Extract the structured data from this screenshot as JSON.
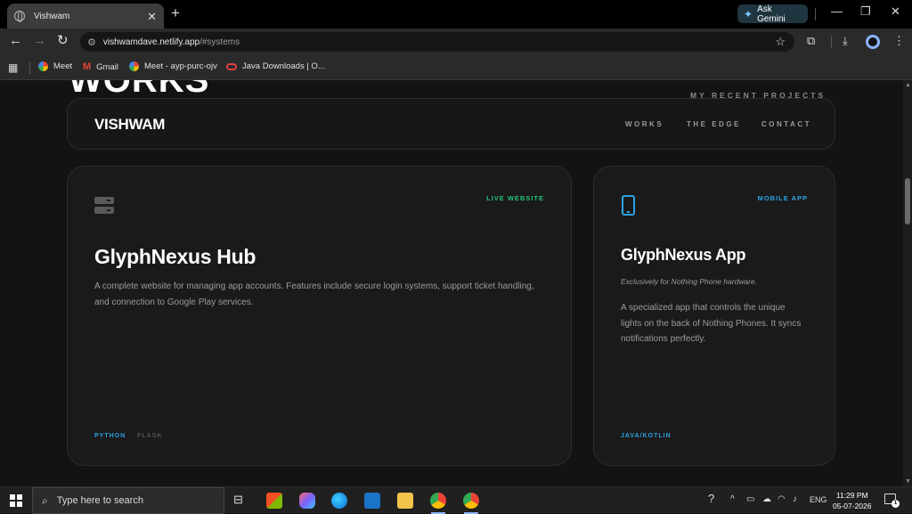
{
  "browser": {
    "tab_title": "Vishwam",
    "tab_close": "✕",
    "new_tab": "+",
    "gemini_label": "Ask Gemini",
    "window_controls": {
      "minimize": "—",
      "restore": "❐",
      "close": "✕"
    },
    "nav": {
      "back": "←",
      "forward": "→",
      "reload": "↻"
    },
    "url_host": "vishwamdave.netlify.app",
    "url_path": "/#systems",
    "bookmark_star": "☆",
    "bookmarks": [
      {
        "label": "Meet",
        "icon": "google-icon"
      },
      {
        "label": "Gmail",
        "icon": "gmail-icon"
      },
      {
        "label": "Meet - ayp-purc-ojv",
        "icon": "google-icon"
      },
      {
        "label": "Java Downloads | O...",
        "icon": "oracle-icon"
      }
    ]
  },
  "page": {
    "bg_heading": "WORKS",
    "bg_subheading": "MY RECENT PROJECTS",
    "nav": {
      "logo": "VISHWAM",
      "links": [
        "WORKS",
        "THE EDGE",
        "CONTACT"
      ]
    },
    "projects": [
      {
        "tag": "LIVE WEBSITE",
        "tag_color": "#22c07a",
        "icon": "server-icon",
        "title": "GlyphNexus Hub",
        "description": "A complete website for managing app accounts. Features include secure login systems, support ticket handling, and connection to Google Play services.",
        "stack": [
          "PYTHON",
          "FLASK"
        ]
      },
      {
        "tag": "MOBILE APP",
        "tag_color": "#2ba3e6",
        "icon": "phone-icon",
        "title": "GlyphNexus App",
        "subtitle": "Exclusively for Nothing Phone hardware.",
        "description": "A specialized app that controls the unique lights on the back of Nothing Phones. It syncs notifications perfectly.",
        "stack": [
          "JAVA/KOTLIN"
        ]
      }
    ],
    "accent_color": "#2ba3e6"
  },
  "taskbar": {
    "search_placeholder": "Type here to search",
    "language": "ENG",
    "time": "11:29 PM",
    "date": "05-07-2026",
    "notification_count": "1"
  }
}
